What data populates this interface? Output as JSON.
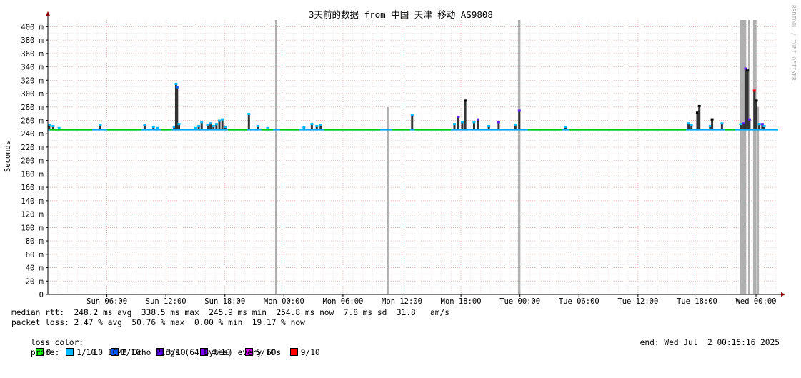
{
  "chart_data": {
    "type": "line",
    "title": "3天前的数据 from 中国 天津 移动 AS9808",
    "ylabel": "Seconds",
    "side_label": "RRDTOOL / TOBI OETIKER",
    "ylim": [
      0,
      410
    ],
    "yticks": [
      0,
      20,
      40,
      60,
      80,
      100,
      120,
      140,
      160,
      180,
      200,
      220,
      240,
      260,
      280,
      300,
      320,
      340,
      360,
      380,
      400
    ],
    "ytick_labels": [
      "0",
      "20 m",
      "40 m",
      "60 m",
      "80 m",
      "100 m",
      "120 m",
      "140 m",
      "160 m",
      "180 m",
      "200 m",
      "220 m",
      "240 m",
      "260 m",
      "280 m",
      "300 m",
      "320 m",
      "340 m",
      "360 m",
      "380 m",
      "400 m"
    ],
    "xlim": [
      -2,
      72.25
    ],
    "xticks": [
      4,
      10,
      16,
      22,
      28,
      34,
      40,
      46,
      52,
      58,
      64,
      70
    ],
    "xtick_labels": [
      "Sun 06:00",
      "Sun 12:00",
      "Sun 18:00",
      "Mon 00:00",
      "Mon 06:00",
      "Mon 12:00",
      "Mon 18:00",
      "Tue 00:00",
      "Tue 06:00",
      "Tue 12:00",
      "Tue 18:00",
      "Wed 00:00"
    ],
    "grid": true,
    "median_rtt_baseline": 246,
    "loss_bars": [
      {
        "x": 21.1,
        "w": 0.2,
        "top": 410
      },
      {
        "x": 32.5,
        "w": 0.15,
        "top": 280
      },
      {
        "x": 45.8,
        "w": 0.25,
        "top": 410
      },
      {
        "x": 68.4,
        "w": 0.6,
        "top": 410
      },
      {
        "x": 69.2,
        "w": 0.2,
        "top": 410
      },
      {
        "x": 69.7,
        "w": 0.35,
        "top": 410
      },
      {
        "x": 70.1,
        "w": 0.2,
        "top": 280
      }
    ],
    "spikes": [
      {
        "x": -1.9,
        "v": 254,
        "c": "#00b8ff"
      },
      {
        "x": -1.5,
        "v": 252,
        "c": "#00b8ff"
      },
      {
        "x": -0.9,
        "v": 249,
        "c": "#00b8ff"
      },
      {
        "x": 3.3,
        "v": 253,
        "c": "#00b8ff"
      },
      {
        "x": 7.8,
        "v": 254,
        "c": "#00b8ff"
      },
      {
        "x": 8.7,
        "v": 251,
        "c": "#00b8ff"
      },
      {
        "x": 9.1,
        "v": 249,
        "c": "#00b8ff"
      },
      {
        "x": 10.8,
        "v": 251,
        "c": "#00b8ff"
      },
      {
        "x": 11.0,
        "v": 315,
        "c": "#00b8ff"
      },
      {
        "x": 11.1,
        "v": 310,
        "c": "#0060ff"
      },
      {
        "x": 11.3,
        "v": 255,
        "c": "#00b8ff"
      },
      {
        "x": 13.0,
        "v": 249,
        "c": "#00b8ff"
      },
      {
        "x": 13.3,
        "v": 252,
        "c": "#00b8ff"
      },
      {
        "x": 13.6,
        "v": 258,
        "c": "#00b8ff"
      },
      {
        "x": 14.2,
        "v": 254,
        "c": "#00b8ff"
      },
      {
        "x": 14.5,
        "v": 256,
        "c": "#00b8ff"
      },
      {
        "x": 14.8,
        "v": 252,
        "c": "#00b8ff"
      },
      {
        "x": 15.1,
        "v": 255,
        "c": "#00b8ff"
      },
      {
        "x": 15.4,
        "v": 260,
        "c": "#00b8ff"
      },
      {
        "x": 15.7,
        "v": 262,
        "c": "#00b8ff"
      },
      {
        "x": 16.0,
        "v": 251,
        "c": "#00b8ff"
      },
      {
        "x": 18.4,
        "v": 270,
        "c": "#00b8ff"
      },
      {
        "x": 19.3,
        "v": 252,
        "c": "#00b8ff"
      },
      {
        "x": 20.3,
        "v": 249,
        "c": "#00b8ff"
      },
      {
        "x": 24.0,
        "v": 250,
        "c": "#00b8ff"
      },
      {
        "x": 24.8,
        "v": 255,
        "c": "#00b8ff"
      },
      {
        "x": 25.3,
        "v": 252,
        "c": "#00b8ff"
      },
      {
        "x": 25.7,
        "v": 254,
        "c": "#00b8ff"
      },
      {
        "x": 35.0,
        "v": 268,
        "c": "#00b8ff"
      },
      {
        "x": 39.3,
        "v": 255,
        "c": "#00b8ff"
      },
      {
        "x": 39.7,
        "v": 266,
        "c": "#6020ff"
      },
      {
        "x": 40.1,
        "v": 258,
        "c": "#00b8ff"
      },
      {
        "x": 40.4,
        "v": 290,
        "c": "#000000"
      },
      {
        "x": 41.3,
        "v": 258,
        "c": "#00b8ff"
      },
      {
        "x": 41.7,
        "v": 262,
        "c": "#6020ff"
      },
      {
        "x": 42.8,
        "v": 252,
        "c": "#00b8ff"
      },
      {
        "x": 43.8,
        "v": 258,
        "c": "#6020ff"
      },
      {
        "x": 45.5,
        "v": 253,
        "c": "#00b8ff"
      },
      {
        "x": 45.9,
        "v": 275,
        "c": "#6020ff"
      },
      {
        "x": 50.6,
        "v": 251,
        "c": "#00b8ff"
      },
      {
        "x": 63.1,
        "v": 256,
        "c": "#00b8ff"
      },
      {
        "x": 63.4,
        "v": 254,
        "c": "#00b8ff"
      },
      {
        "x": 64.0,
        "v": 272,
        "c": "#000000"
      },
      {
        "x": 64.2,
        "v": 282,
        "c": "#000000"
      },
      {
        "x": 65.3,
        "v": 252,
        "c": "#00b8ff"
      },
      {
        "x": 65.5,
        "v": 262,
        "c": "#000000"
      },
      {
        "x": 66.5,
        "v": 256,
        "c": "#00b8ff"
      },
      {
        "x": 68.4,
        "v": 255,
        "c": "#00b8ff"
      },
      {
        "x": 68.7,
        "v": 256,
        "c": "#6020ff"
      },
      {
        "x": 68.9,
        "v": 338,
        "c": "#6020ff"
      },
      {
        "x": 69.1,
        "v": 335,
        "c": "#000000"
      },
      {
        "x": 69.3,
        "v": 262,
        "c": "#6020ff"
      },
      {
        "x": 69.8,
        "v": 305,
        "c": "#ff0000"
      },
      {
        "x": 70.0,
        "v": 290,
        "c": "#000000"
      },
      {
        "x": 70.3,
        "v": 255,
        "c": "#00b8ff"
      },
      {
        "x": 70.6,
        "v": 255,
        "c": "#6020ff"
      },
      {
        "x": 70.8,
        "v": 252,
        "c": "#00b8ff"
      }
    ],
    "green_segments": [
      [
        -1.8,
        2.5
      ],
      [
        4.0,
        7.5
      ],
      [
        9.5,
        10.6
      ],
      [
        16.3,
        18.2
      ],
      [
        19.7,
        20.9
      ],
      [
        21.6,
        23.5
      ],
      [
        26.1,
        31.8
      ],
      [
        33.0,
        34.8
      ],
      [
        35.3,
        39.0
      ],
      [
        46.8,
        50.3
      ],
      [
        51.0,
        62.9
      ],
      [
        66.8,
        67.9
      ]
    ],
    "colors": {
      "median": "#00cc00",
      "loss_bg": "#b0b0b0",
      "grid_minor": "#e9c9c9",
      "grid_major": "#ec9d9d",
      "axis": "#000000",
      "arrow": "#8b0000"
    }
  },
  "stats": {
    "median_rtt": "median rtt:  248.2 ms avg  338.5 ms max  245.9 ms min  254.8 ms now  7.8 ms sd  31.8   am/s",
    "packet_loss": "packet loss: 2.47 % avg  50.76 % max  0.00 % min  19.17 % now",
    "loss_color_label": "loss color:",
    "legend": [
      {
        "label": "0",
        "color": "#00ff00"
      },
      {
        "label": "1/10",
        "color": "#00b8ff"
      },
      {
        "label": "2/10",
        "color": "#0059ff"
      },
      {
        "label": "3/10",
        "color": "#5e00ff"
      },
      {
        "label": "4/10",
        "color": "#7e00ff"
      },
      {
        "label": "5/10",
        "color": "#dd00ff"
      },
      {
        "label": "9/10",
        "color": "#ff0000"
      }
    ],
    "probe": "probe:       10 ICMP Echo Pings (64 Bytes) every 60s",
    "end": "end: Wed Jul  2 00:15:16 2025"
  }
}
